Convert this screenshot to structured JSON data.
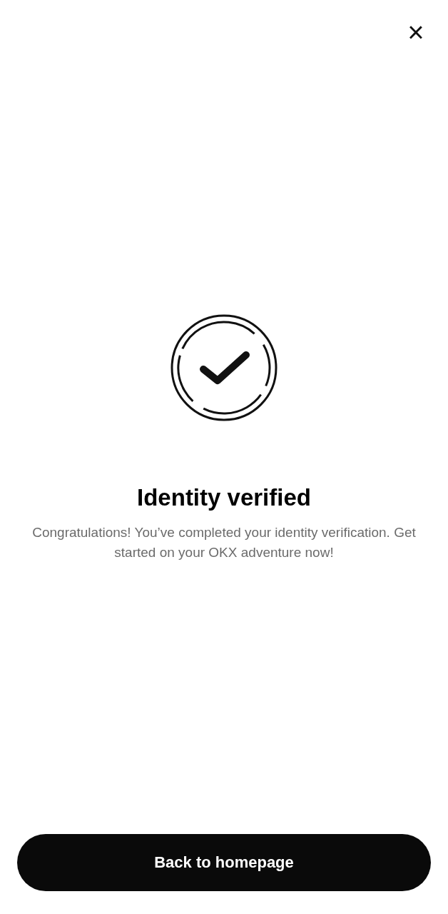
{
  "close_button": {
    "label": "×"
  },
  "status": {
    "kind": "success",
    "title": "Identity verified",
    "message": "Congratulations! You’ve completed your identity verification. Get started on your OKX adventure now!"
  },
  "primary_button": {
    "label": "Back to homepage"
  }
}
